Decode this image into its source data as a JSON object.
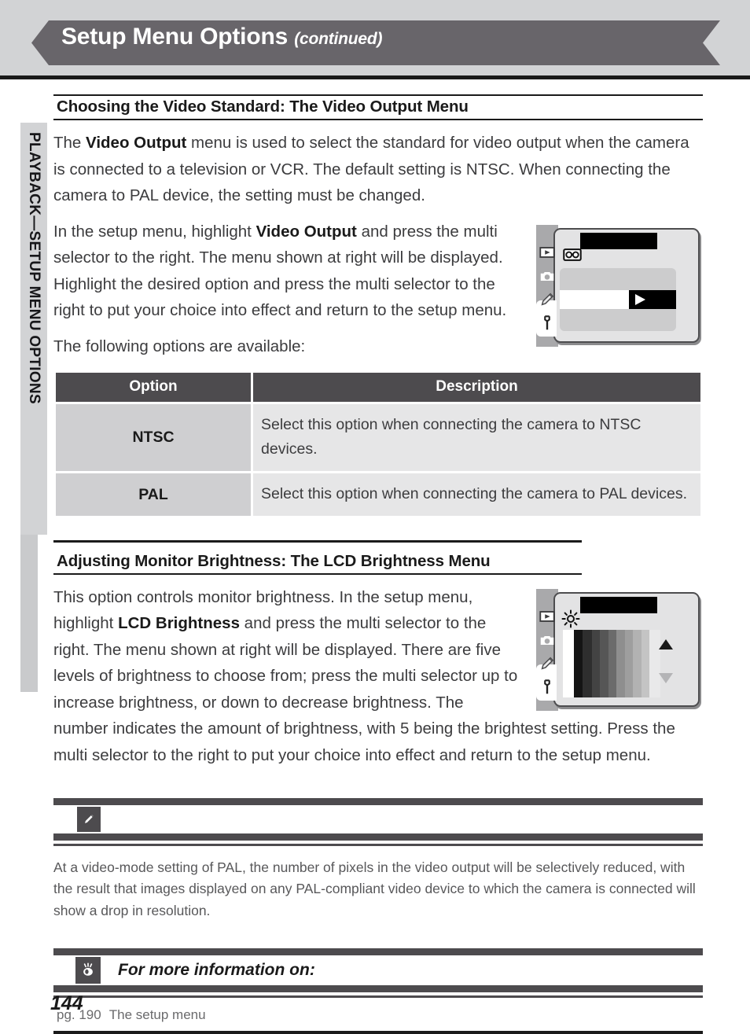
{
  "header": {
    "title": "Setup Menu Options",
    "continued": "(continued)"
  },
  "sidebar": {
    "label": "PLAYBACK—SETUP MENU OPTIONS"
  },
  "section1": {
    "heading": "Choosing the Video Standard: The Video Output Menu",
    "para1_a": "The ",
    "para1_b": "Video Output",
    "para1_c": " menu is used to select the standard for video output when the camera is connected to a television or VCR.  The default setting is NTSC.  When connecting the camera to PAL device, the setting must be changed.",
    "para2_a": "In the setup menu, highlight ",
    "para2_b": "Video Output",
    "para2_c": " and press the multi selector to the right.  The menu shown at right will be displayed.  Highlight the desired option and press the multi selector to the right to put your choice into effect and return to the setup menu.",
    "para3": "The following options are available:",
    "lcd": {
      "tab_icons": [
        "playback-icon",
        "camera-icon",
        "pencil-icon",
        "wrench-icon"
      ],
      "menu_icon": "film-cartridge-icon",
      "selection_arrow": "right-arrow-icon"
    },
    "table": {
      "headers": [
        "Option",
        "Description"
      ],
      "rows": [
        {
          "option": "NTSC",
          "description": "Select this option when connecting the camera to NTSC devices."
        },
        {
          "option": "PAL",
          "description": "Select this option when connecting the camera to PAL devices."
        }
      ]
    }
  },
  "section2": {
    "heading": "Adjusting Monitor Brightness: The LCD Brightness Menu",
    "para_a": "This option controls monitor brightness.  In the setup menu, highlight ",
    "para_b": "LCD Brightness",
    "para_c": " and press the multi selector to the right. The menu shown at right will be displayed. There are five levels of brightness to choose from; press the multi selector up to increase brightness, or down to decrease brightness.  The number indicates the amount of brightness, with 5 being the brightest setting.  Press the multi selector to the right to put your choice into effect and return to the setup menu.",
    "lcd": {
      "tab_icons": [
        "playback-icon",
        "camera-icon",
        "pencil-icon",
        "wrench-icon"
      ],
      "menu_icon": "sun-brightness-icon",
      "up_arrow": "triangle-up-icon",
      "down_arrow": "triangle-down-icon",
      "gradient_steps": [
        "#ffffff",
        "#141414",
        "#2e2e2e",
        "#434343",
        "#565656",
        "#6b6b6b",
        "#8e8e8e",
        "#9e9e9e",
        "#b2b2b2",
        "#c4c4c4",
        "#e3e3e4"
      ]
    }
  },
  "note": {
    "icon": "pencil-note-icon",
    "body": "At a video-mode setting of PAL, the number of pixels in the video output will be selectively reduced, with the result that images displayed on any PAL-compliant video device to which the camera is connected will show a drop in resolution."
  },
  "for_more_info": {
    "icon": "eye-icon",
    "title": "For more information on:",
    "entries": [
      {
        "page": "pg. 190",
        "text": "The setup menu"
      }
    ]
  },
  "page_number": "144",
  "colors": {
    "banner": "#68656a",
    "header_zone": "#d2d3d5",
    "table_header": "#4d4b4e",
    "table_option_cell": "#cfcfd1",
    "table_desc_cell": "#e6e6e7",
    "sidebar_tab": "#d2d3d5"
  }
}
